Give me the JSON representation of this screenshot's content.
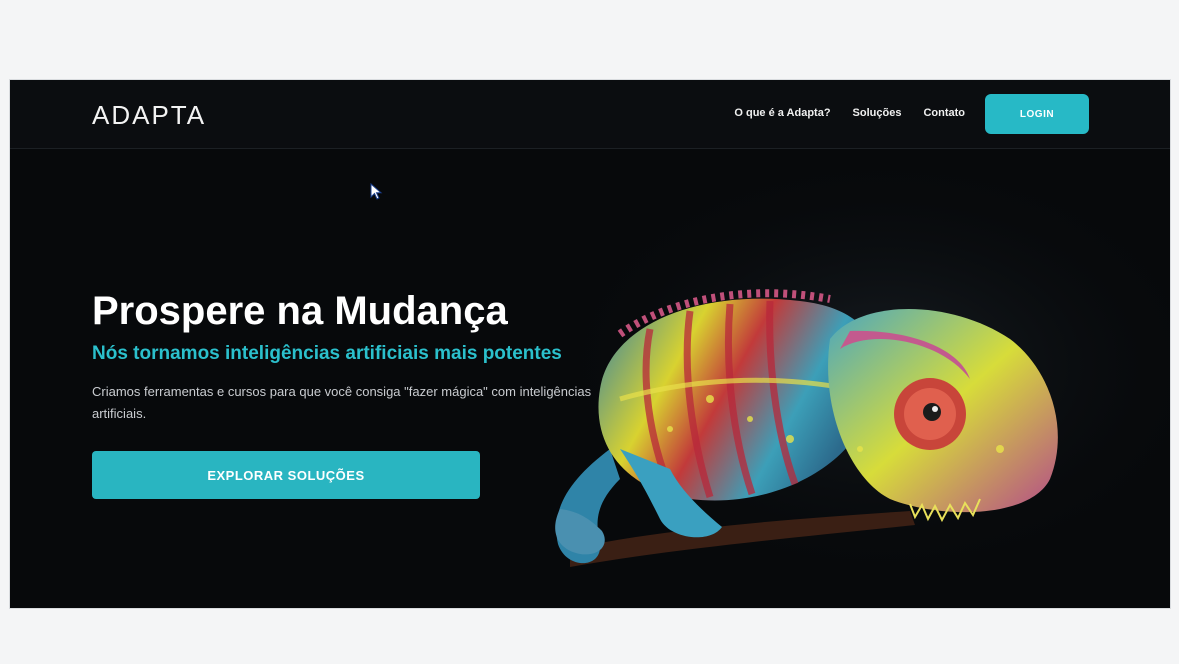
{
  "header": {
    "logo": "ADAPTA",
    "nav": [
      {
        "label": "O que é a Adapta?"
      },
      {
        "label": "Soluções"
      },
      {
        "label": "Contato"
      }
    ],
    "login_label": "LOGIN"
  },
  "hero": {
    "title": "Prospere na Mudança",
    "subtitle": "Nós tornamos inteligências artificiais mais potentes",
    "description": "Criamos ferramentas e cursos para que você consiga \"fazer mágica\" com inteligências artificiais.",
    "cta_label": "EXPLORAR SOLUÇÕES"
  },
  "colors": {
    "accent": "#27b9c6",
    "background": "#07090b",
    "subtitle": "#2bc0cc"
  },
  "icons": [
    "cursor-icon",
    "chameleon-image"
  ]
}
